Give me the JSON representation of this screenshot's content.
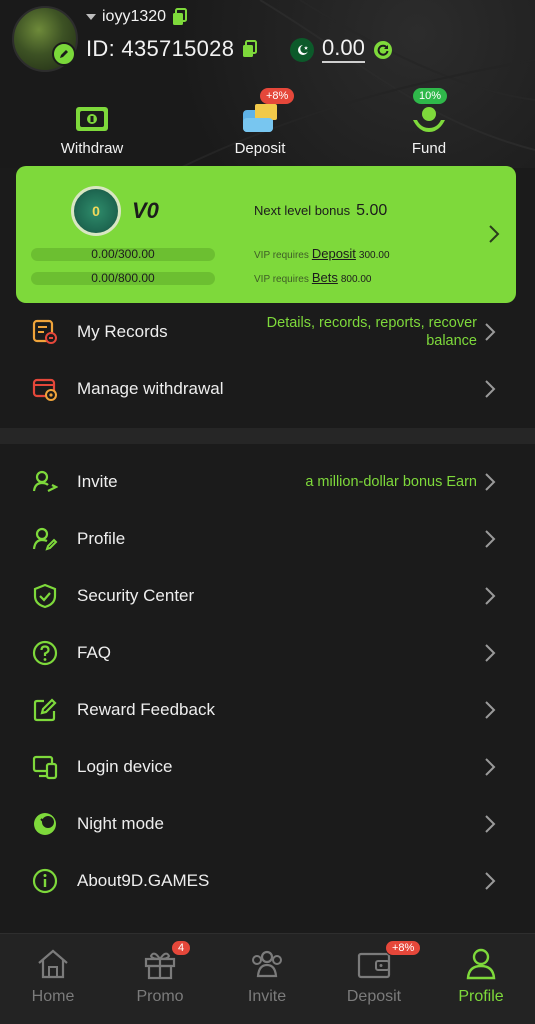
{
  "user": {
    "username": "ioyy1320",
    "id_label": "ID: 435715028",
    "balance": "0.00"
  },
  "quick_actions": [
    {
      "label": "Withdraw",
      "icon": "withdraw-icon"
    },
    {
      "label": "Deposit",
      "icon": "deposit-icon",
      "badge": "+8%"
    },
    {
      "label": "Fund",
      "icon": "fund-icon",
      "badge": "10%"
    }
  ],
  "vip": {
    "level": "V0",
    "next_level_bonus_label": "Next level bonus",
    "next_level_bonus": "5.00",
    "deposit_progress": "0.00/300.00",
    "bets_progress": "0.00/800.00",
    "deposit_req_prefix": "VIP requires",
    "deposit_req_link": "Deposit",
    "deposit_req_value": "300.00",
    "bets_req_prefix": "VIP requires",
    "bets_req_link": "Bets",
    "bets_req_value": "800.00"
  },
  "records": {
    "label": "My Records",
    "hint_line1": "Details, records, reports, recover",
    "hint_line2": "balance"
  },
  "manage_withdrawal": {
    "label": "Manage withdrawal"
  },
  "menu": [
    {
      "label": "Invite",
      "icon": "invite-icon",
      "hint": "a million-dollar bonus  Earn"
    },
    {
      "label": "Profile",
      "icon": "profile-icon"
    },
    {
      "label": "Security Center",
      "icon": "shield-icon"
    },
    {
      "label": "FAQ",
      "icon": "question-icon"
    },
    {
      "label": "Reward Feedback",
      "icon": "edit-icon"
    },
    {
      "label": "Login device",
      "icon": "device-icon"
    },
    {
      "label": "Night mode",
      "icon": "moon-icon"
    },
    {
      "label": "About9D.GAMES",
      "icon": "info-icon"
    }
  ],
  "bottom_nav": [
    {
      "label": "Home",
      "icon": "home-icon"
    },
    {
      "label": "Promo",
      "icon": "gift-icon",
      "badge": "4"
    },
    {
      "label": "Invite",
      "icon": "users-icon"
    },
    {
      "label": "Deposit",
      "icon": "wallet-icon",
      "badge": "+8%"
    },
    {
      "label": "Profile",
      "icon": "profile-icon",
      "active": true
    }
  ],
  "colors": {
    "accent": "#7ED93B",
    "background": "#1B1B1B",
    "badge_red": "#E5473A"
  }
}
